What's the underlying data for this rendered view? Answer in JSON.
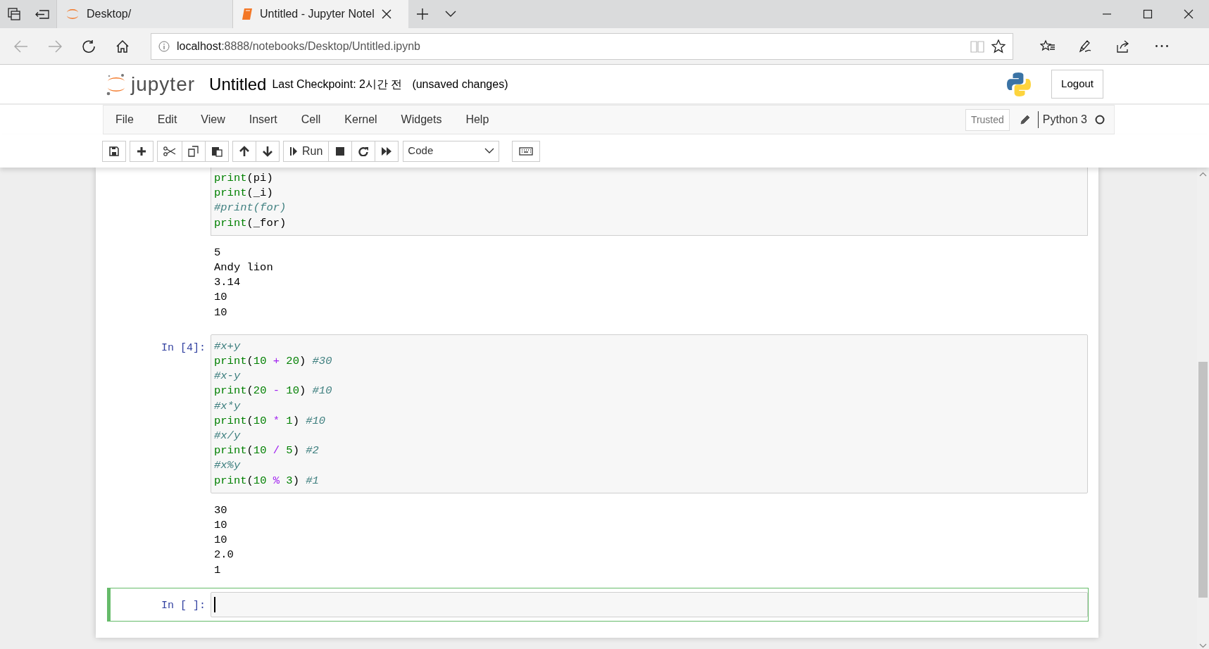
{
  "browser": {
    "tabs": [
      {
        "title": "Desktop/",
        "selected": false
      },
      {
        "title": "Untitled - Jupyter Notel",
        "selected": true
      }
    ],
    "address": {
      "host": "localhost",
      "rest": ":8888/notebooks/Desktop/Untitled.ipynb"
    }
  },
  "header": {
    "logo_text": "jupyter",
    "notebook_name": "Untitled",
    "checkpoint": "Last Checkpoint: 2시간 전",
    "autosave": "(unsaved changes)",
    "logout": "Logout"
  },
  "menu": {
    "items": [
      "File",
      "Edit",
      "View",
      "Insert",
      "Cell",
      "Kernel",
      "Widgets",
      "Help"
    ],
    "trusted": "Trusted",
    "kernel": "Python 3"
  },
  "toolbar": {
    "run": "Run",
    "cell_type": "Code"
  },
  "cells": [
    {
      "selected": false,
      "code": [
        [
          {
            "text": "print",
            "kind": "builtin"
          },
          {
            "text": "(pi)",
            "kind": "plain"
          }
        ],
        [
          {
            "text": "print",
            "kind": "builtin"
          },
          {
            "text": "(_i)",
            "kind": "plain"
          }
        ],
        [
          {
            "text": "#print(for)",
            "kind": "comment"
          }
        ],
        [
          {
            "text": "print",
            "kind": "builtin"
          },
          {
            "text": "(_for)",
            "kind": "plain"
          }
        ]
      ],
      "outputs": [
        "5",
        "Andy lion",
        "3.14",
        "10",
        "10"
      ]
    },
    {
      "prompt": "In [4]:",
      "selected": false,
      "code": [
        [
          {
            "text": "#x+y",
            "kind": "comment"
          }
        ],
        [
          {
            "text": "print",
            "kind": "builtin"
          },
          {
            "text": "(",
            "kind": "plain"
          },
          {
            "text": "10",
            "kind": "number"
          },
          {
            "text": "+",
            "kind": "op"
          },
          {
            "text": "20",
            "kind": "number"
          },
          {
            "text": ") ",
            "kind": "plain"
          },
          {
            "text": "#30",
            "kind": "comment"
          }
        ],
        [
          {
            "text": "#x-y",
            "kind": "comment"
          }
        ],
        [
          {
            "text": "print",
            "kind": "builtin"
          },
          {
            "text": "(",
            "kind": "plain"
          },
          {
            "text": "20",
            "kind": "number"
          },
          {
            "text": "-",
            "kind": "op"
          },
          {
            "text": "10",
            "kind": "number"
          },
          {
            "text": ") ",
            "kind": "plain"
          },
          {
            "text": "#10",
            "kind": "comment"
          }
        ],
        [
          {
            "text": "#x*y",
            "kind": "comment"
          }
        ],
        [
          {
            "text": "print",
            "kind": "builtin"
          },
          {
            "text": "(",
            "kind": "plain"
          },
          {
            "text": "10",
            "kind": "number"
          },
          {
            "text": "*",
            "kind": "op"
          },
          {
            "text": "1",
            "kind": "number"
          },
          {
            "text": ") ",
            "kind": "plain"
          },
          {
            "text": "#10",
            "kind": "comment"
          }
        ],
        [
          {
            "text": "#x/y",
            "kind": "comment"
          }
        ],
        [
          {
            "text": "print",
            "kind": "builtin"
          },
          {
            "text": "(",
            "kind": "plain"
          },
          {
            "text": "10",
            "kind": "number"
          },
          {
            "text": "/",
            "kind": "op"
          },
          {
            "text": "5",
            "kind": "number"
          },
          {
            "text": ") ",
            "kind": "plain"
          },
          {
            "text": "#2",
            "kind": "comment"
          }
        ],
        [
          {
            "text": "#x%y",
            "kind": "comment"
          }
        ],
        [
          {
            "text": "print",
            "kind": "builtin"
          },
          {
            "text": "(",
            "kind": "plain"
          },
          {
            "text": "10",
            "kind": "number"
          },
          {
            "text": "%",
            "kind": "op"
          },
          {
            "text": "3",
            "kind": "number"
          },
          {
            "text": ") ",
            "kind": "plain"
          },
          {
            "text": "#1",
            "kind": "comment"
          }
        ]
      ],
      "outputs": [
        "30",
        "10",
        "10",
        "2.0",
        "1"
      ]
    },
    {
      "prompt": "In [ ]:",
      "selected": true
    }
  ]
}
